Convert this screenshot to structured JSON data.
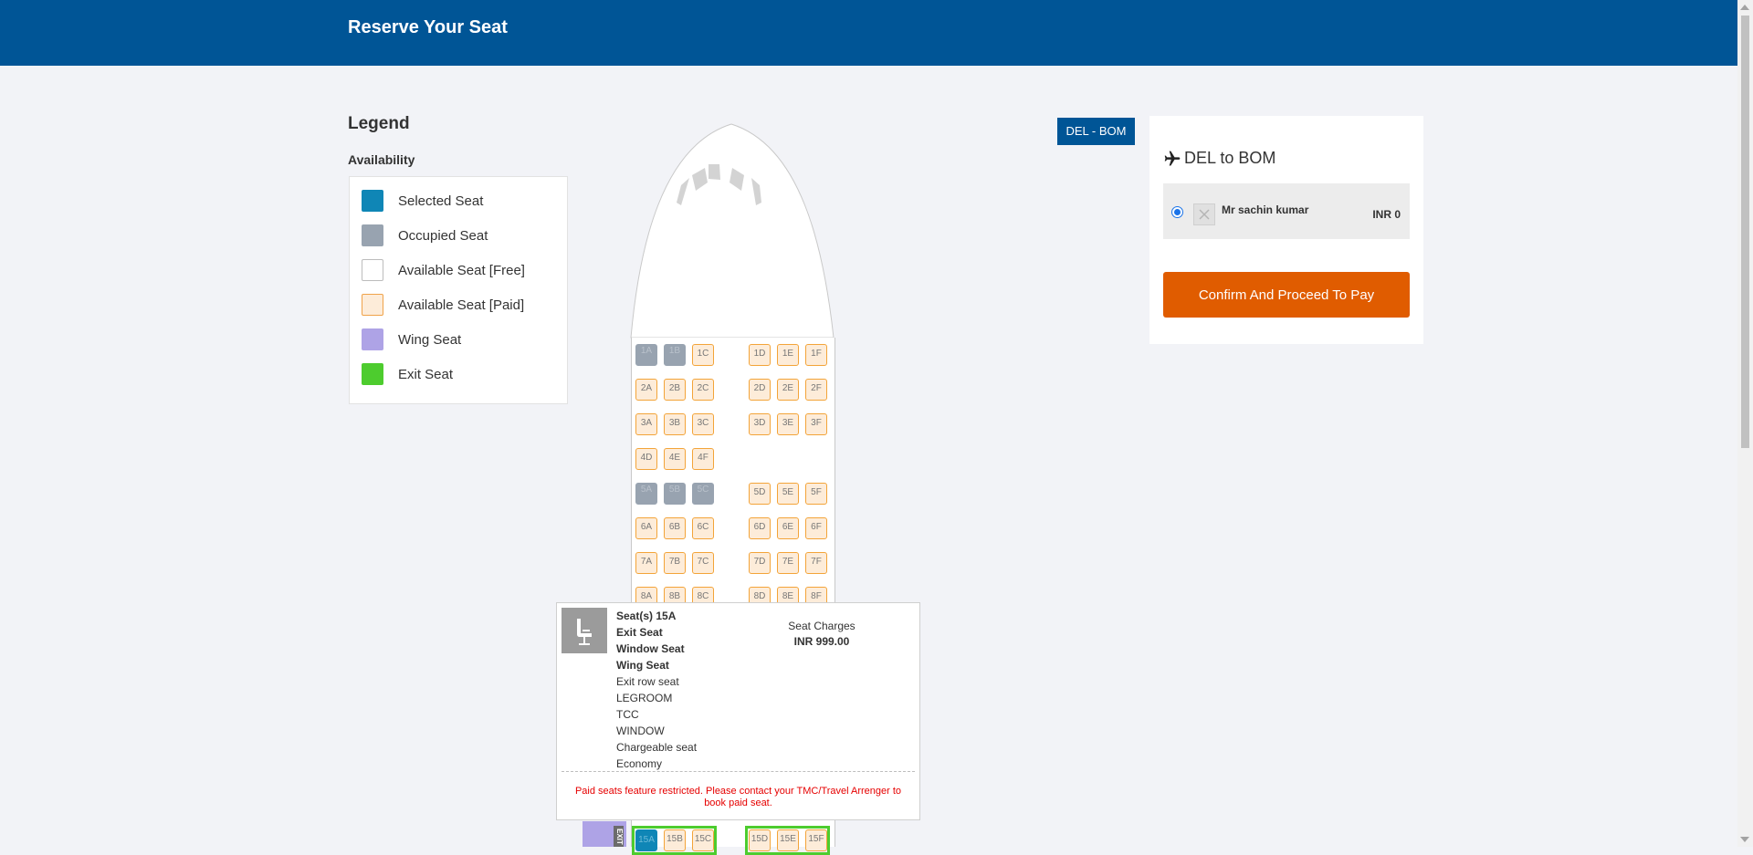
{
  "header": {
    "title": "Reserve Your Seat"
  },
  "legend": {
    "title": "Legend",
    "availability_label": "Availability",
    "items": [
      {
        "label": "Selected Seat",
        "color": "#0f86b6"
      },
      {
        "label": "Occupied Seat",
        "color": "#98a3b0"
      },
      {
        "label": "Available Seat [Free]",
        "color": "#ffffff"
      },
      {
        "label": "Available Seat [Paid]",
        "color": "#fdecd9"
      },
      {
        "label": "Wing Seat",
        "color": "#aea3e6"
      },
      {
        "label": "Exit Seat",
        "color": "#4dcc2e"
      }
    ]
  },
  "seatmap": {
    "rows": [
      {
        "left": [
          {
            "id": "1A",
            "status": "occupied"
          },
          {
            "id": "1B",
            "status": "occupied"
          },
          {
            "id": "1C",
            "status": "paid"
          }
        ],
        "right": [
          {
            "id": "1D",
            "status": "paid"
          },
          {
            "id": "1E",
            "status": "paid"
          },
          {
            "id": "1F",
            "status": "paid"
          }
        ]
      },
      {
        "left": [
          {
            "id": "2A",
            "status": "paid"
          },
          {
            "id": "2B",
            "status": "paid"
          },
          {
            "id": "2C",
            "status": "paid"
          }
        ],
        "right": [
          {
            "id": "2D",
            "status": "paid"
          },
          {
            "id": "2E",
            "status": "paid"
          },
          {
            "id": "2F",
            "status": "paid"
          }
        ]
      },
      {
        "left": [
          {
            "id": "3A",
            "status": "paid"
          },
          {
            "id": "3B",
            "status": "paid"
          },
          {
            "id": "3C",
            "status": "paid"
          }
        ],
        "right": [
          {
            "id": "3D",
            "status": "paid"
          },
          {
            "id": "3E",
            "status": "paid"
          },
          {
            "id": "3F",
            "status": "paid"
          }
        ]
      },
      {
        "left": [
          {
            "id": "4D",
            "status": "paid"
          },
          {
            "id": "4E",
            "status": "paid"
          },
          {
            "id": "4F",
            "status": "paid"
          }
        ],
        "right": []
      },
      {
        "left": [
          {
            "id": "5A",
            "status": "occupied"
          },
          {
            "id": "5B",
            "status": "occupied"
          },
          {
            "id": "5C",
            "status": "occupied"
          }
        ],
        "right": [
          {
            "id": "5D",
            "status": "paid"
          },
          {
            "id": "5E",
            "status": "paid"
          },
          {
            "id": "5F",
            "status": "paid"
          }
        ]
      },
      {
        "left": [
          {
            "id": "6A",
            "status": "paid"
          },
          {
            "id": "6B",
            "status": "paid"
          },
          {
            "id": "6C",
            "status": "paid"
          }
        ],
        "right": [
          {
            "id": "6D",
            "status": "paid"
          },
          {
            "id": "6E",
            "status": "paid"
          },
          {
            "id": "6F",
            "status": "paid"
          }
        ]
      },
      {
        "left": [
          {
            "id": "7A",
            "status": "paid"
          },
          {
            "id": "7B",
            "status": "paid"
          },
          {
            "id": "7C",
            "status": "paid"
          }
        ],
        "right": [
          {
            "id": "7D",
            "status": "paid"
          },
          {
            "id": "7E",
            "status": "paid"
          },
          {
            "id": "7F",
            "status": "paid"
          }
        ]
      },
      {
        "left": [
          {
            "id": "8A",
            "status": "paid"
          },
          {
            "id": "8B",
            "status": "paid"
          },
          {
            "id": "8C",
            "status": "paid"
          }
        ],
        "right": [
          {
            "id": "8D",
            "status": "paid"
          },
          {
            "id": "8E",
            "status": "paid"
          },
          {
            "id": "8F",
            "status": "paid"
          }
        ]
      },
      {
        "left": [
          {
            "id": "15A",
            "status": "selected"
          },
          {
            "id": "15B",
            "status": "paid"
          },
          {
            "id": "15C",
            "status": "paid"
          }
        ],
        "right": [
          {
            "id": "15D",
            "status": "paid"
          },
          {
            "id": "15E",
            "status": "paid"
          },
          {
            "id": "15F",
            "status": "paid"
          }
        ],
        "exit": true
      }
    ],
    "exit_label": "EXIT"
  },
  "tooltip": {
    "seats": "Seat(s) 15A",
    "features_bold": [
      "Exit Seat",
      "Window Seat",
      "Wing Seat"
    ],
    "features": [
      "Exit row seat",
      "LEGROOM",
      "TCC",
      "WINDOW",
      "Chargeable seat",
      "Economy"
    ],
    "charges_label": "Seat Charges",
    "charges_value": "INR 999.00",
    "warning": "Paid seats feature restricted. Please contact your TMC/Travel Arrenger to book paid seat."
  },
  "route_badge": "DEL - BOM",
  "panel": {
    "route_title": "DEL to BOM",
    "passenger": {
      "name": "Mr sachin kumar",
      "amount": "INR 0",
      "selected": true
    },
    "confirm_label": "Confirm And Proceed To Pay"
  }
}
